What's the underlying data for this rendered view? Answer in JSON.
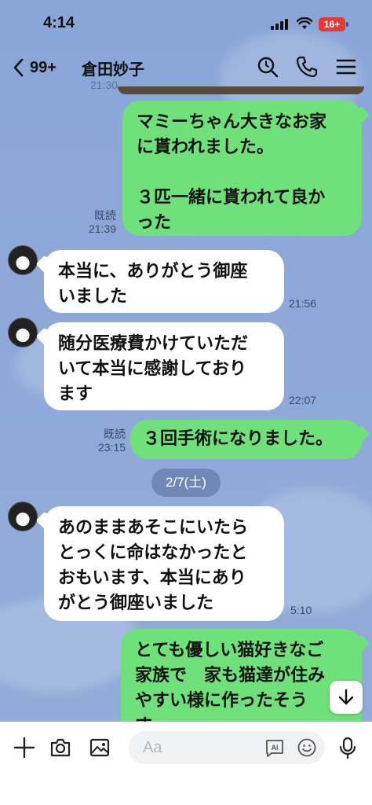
{
  "status_bar": {
    "time": "4:14",
    "battery": "16+"
  },
  "header": {
    "back_count": "99+",
    "contact_name": "倉田妙子"
  },
  "messages": [
    {
      "side": "out",
      "text": "マミーちゃん大きなお家\nに貰われました。\n\n３匹一緒に貰われて良か\nった",
      "read": "既読",
      "time": "21:39"
    },
    {
      "side": "in",
      "text": "本当に、ありがとう御座\nいました",
      "time": "21:56"
    },
    {
      "side": "in",
      "text": "随分医療費かけていただ\nいて本当に感謝しており\nます",
      "time": "22:07"
    },
    {
      "side": "out",
      "text": "３回手術になりました。",
      "read": "既読",
      "time": "23:15"
    },
    {
      "side": "in",
      "text": "あのままあそこにいたら\nとっくに命はなかったと\nおもいます、本当にあり\nがとう御座いました",
      "time": "5:10"
    },
    {
      "side": "out",
      "text": "とても優しい猫好きなご\n家族で　家も猫達が住み\nやすい様に作ったそう\nす"
    }
  ],
  "date_separator": "2/7(土)",
  "partial_timestamp": "21:30",
  "input": {
    "placeholder": "Aa"
  },
  "colors": {
    "outgoing_bubble": "#6fe07a",
    "incoming_bubble": "#ffffff",
    "background": "#8aa5d8",
    "date_pill": "#6f88b8",
    "battery": "#e53935"
  },
  "icons": {
    "header": [
      "chevron-left-icon",
      "search-icon",
      "phone-icon",
      "menu-icon"
    ],
    "input": [
      "plus-icon",
      "camera-icon",
      "image-icon",
      "ai-icon",
      "emoji-icon",
      "microphone-icon"
    ],
    "scroll": "arrow-down-icon"
  }
}
